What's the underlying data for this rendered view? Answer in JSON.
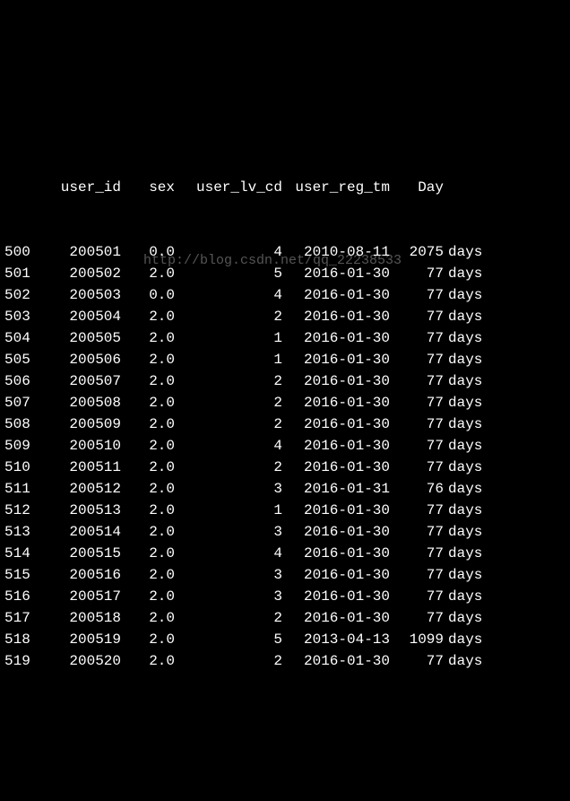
{
  "headers": {
    "idx": "",
    "user_id": "user_id",
    "sex": "sex",
    "user_lv_cd": "user_lv_cd",
    "user_reg_tm": "user_reg_tm",
    "day": "Day"
  },
  "rows": [
    {
      "idx": "500",
      "user_id": "200501",
      "sex": "0.0",
      "user_lv_cd": "4",
      "user_reg_tm": "2010-08-11",
      "day": "2075",
      "days": "days"
    },
    {
      "idx": "501",
      "user_id": "200502",
      "sex": "2.0",
      "user_lv_cd": "5",
      "user_reg_tm": "2016-01-30",
      "day": "77",
      "days": "days"
    },
    {
      "idx": "502",
      "user_id": "200503",
      "sex": "0.0",
      "user_lv_cd": "4",
      "user_reg_tm": "2016-01-30",
      "day": "77",
      "days": "days"
    },
    {
      "idx": "503",
      "user_id": "200504",
      "sex": "2.0",
      "user_lv_cd": "2",
      "user_reg_tm": "2016-01-30",
      "day": "77",
      "days": "days"
    },
    {
      "idx": "504",
      "user_id": "200505",
      "sex": "2.0",
      "user_lv_cd": "1",
      "user_reg_tm": "2016-01-30",
      "day": "77",
      "days": "days"
    },
    {
      "idx": "505",
      "user_id": "200506",
      "sex": "2.0",
      "user_lv_cd": "1",
      "user_reg_tm": "2016-01-30",
      "day": "77",
      "days": "days"
    },
    {
      "idx": "506",
      "user_id": "200507",
      "sex": "2.0",
      "user_lv_cd": "2",
      "user_reg_tm": "2016-01-30",
      "day": "77",
      "days": "days"
    },
    {
      "idx": "507",
      "user_id": "200508",
      "sex": "2.0",
      "user_lv_cd": "2",
      "user_reg_tm": "2016-01-30",
      "day": "77",
      "days": "days"
    },
    {
      "idx": "508",
      "user_id": "200509",
      "sex": "2.0",
      "user_lv_cd": "2",
      "user_reg_tm": "2016-01-30",
      "day": "77",
      "days": "days"
    },
    {
      "idx": "509",
      "user_id": "200510",
      "sex": "2.0",
      "user_lv_cd": "4",
      "user_reg_tm": "2016-01-30",
      "day": "77",
      "days": "days"
    },
    {
      "idx": "510",
      "user_id": "200511",
      "sex": "2.0",
      "user_lv_cd": "2",
      "user_reg_tm": "2016-01-30",
      "day": "77",
      "days": "days"
    },
    {
      "idx": "511",
      "user_id": "200512",
      "sex": "2.0",
      "user_lv_cd": "3",
      "user_reg_tm": "2016-01-31",
      "day": "76",
      "days": "days"
    },
    {
      "idx": "512",
      "user_id": "200513",
      "sex": "2.0",
      "user_lv_cd": "1",
      "user_reg_tm": "2016-01-30",
      "day": "77",
      "days": "days"
    },
    {
      "idx": "513",
      "user_id": "200514",
      "sex": "2.0",
      "user_lv_cd": "3",
      "user_reg_tm": "2016-01-30",
      "day": "77",
      "days": "days"
    },
    {
      "idx": "514",
      "user_id": "200515",
      "sex": "2.0",
      "user_lv_cd": "4",
      "user_reg_tm": "2016-01-30",
      "day": "77",
      "days": "days"
    },
    {
      "idx": "515",
      "user_id": "200516",
      "sex": "2.0",
      "user_lv_cd": "3",
      "user_reg_tm": "2016-01-30",
      "day": "77",
      "days": "days"
    },
    {
      "idx": "516",
      "user_id": "200517",
      "sex": "2.0",
      "user_lv_cd": "3",
      "user_reg_tm": "2016-01-30",
      "day": "77",
      "days": "days"
    },
    {
      "idx": "517",
      "user_id": "200518",
      "sex": "2.0",
      "user_lv_cd": "2",
      "user_reg_tm": "2016-01-30",
      "day": "77",
      "days": "days"
    },
    {
      "idx": "518",
      "user_id": "200519",
      "sex": "2.0",
      "user_lv_cd": "5",
      "user_reg_tm": "2013-04-13",
      "day": "1099",
      "days": "days"
    },
    {
      "idx": "519",
      "user_id": "200520",
      "sex": "2.0",
      "user_lv_cd": "2",
      "user_reg_tm": "2016-01-30",
      "day": "77",
      "days": "days"
    }
  ],
  "watermark": "http://blog.csdn.net/qq_22238533"
}
